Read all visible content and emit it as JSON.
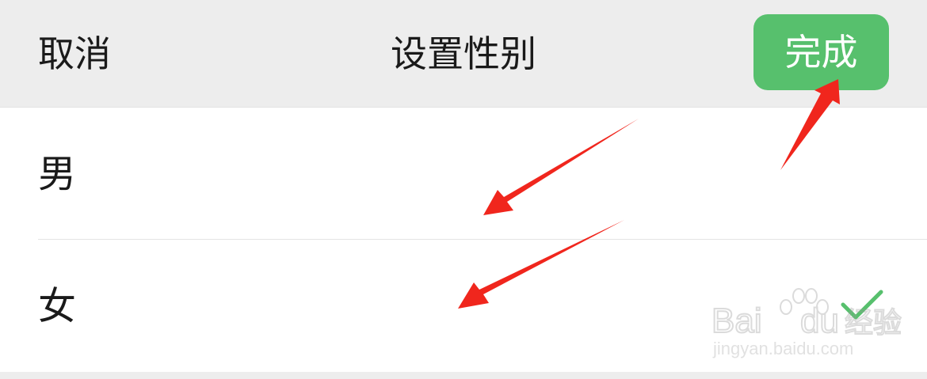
{
  "header": {
    "cancel_label": "取消",
    "title": "设置性别",
    "done_label": "完成"
  },
  "options": [
    {
      "label": "男",
      "selected": false
    },
    {
      "label": "女",
      "selected": true
    }
  ],
  "colors": {
    "header_bg": "#ededed",
    "done_button": "#57c06d",
    "check": "#57c06d",
    "annotation_arrow": "#f0261d"
  },
  "icons": {
    "selected_check": "checkmark-icon"
  },
  "watermark": {
    "brand": "Bai du 经验",
    "url": "jingyan.baidu.com"
  }
}
